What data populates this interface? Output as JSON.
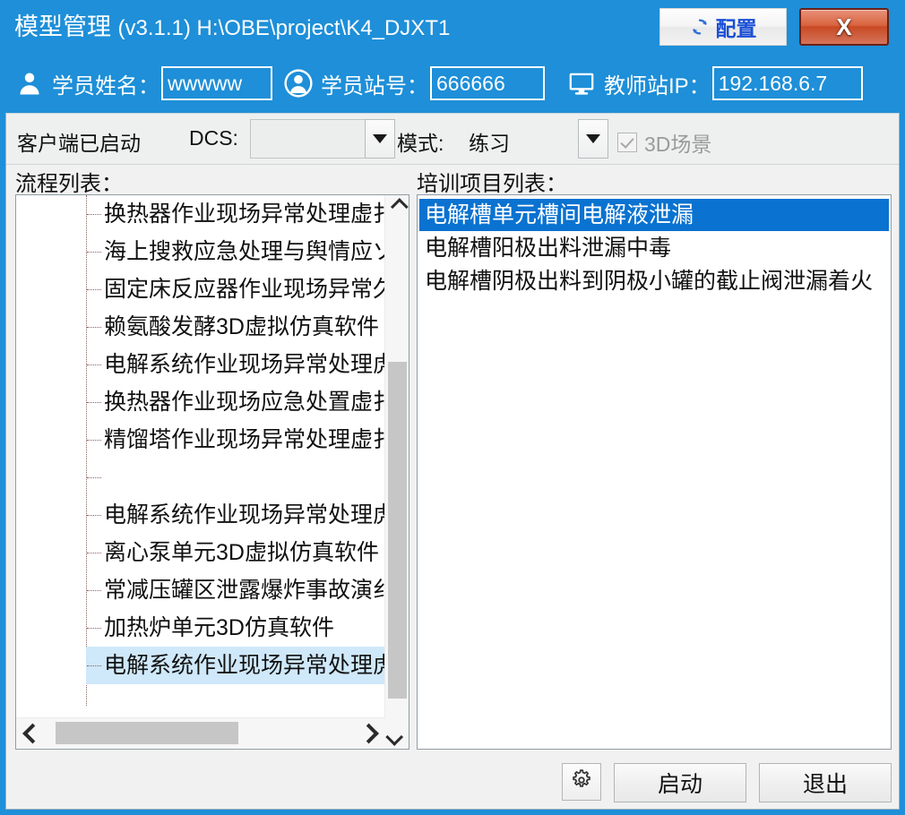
{
  "window": {
    "title_main": "模型管理",
    "title_version": "(v3.1.1) H:\\OBE\\project\\K4_DJXT1",
    "accent_blue": "#1e8fd8",
    "config_button": "配置",
    "close_button": "X"
  },
  "fields": {
    "student_name": {
      "label": "学员姓名：",
      "value": "wwwww",
      "placeholder": ""
    },
    "student_station": {
      "label": "学员站号：",
      "value": "666666",
      "placeholder": ""
    },
    "teacher_ip": {
      "label": "教师站IP：",
      "value": "192.168.6.7",
      "placeholder": ""
    }
  },
  "toolbar": {
    "status": "客户端已启动",
    "dcs_label": "DCS:",
    "dcs_value": "",
    "mode_label": "模式:",
    "mode_value": "练习",
    "scene3d_label": "3D场景",
    "scene3d_checked": true,
    "scene3d_disabled": true
  },
  "process_list": {
    "header": "流程列表：",
    "items": [
      {
        "label": "换热器作业现场异常处理虚扌",
        "selected": false
      },
      {
        "label": "海上搜救应急处理与舆情应ゾ",
        "selected": false
      },
      {
        "label": "固定床反应器作业现场异常久",
        "selected": false
      },
      {
        "label": "赖氨酸发酵3D虚拟仿真软件",
        "selected": false
      },
      {
        "label": "电解系统作业现场异常处理虎",
        "selected": false
      },
      {
        "label": "换热器作业现场应急处置虚扌",
        "selected": false
      },
      {
        "label": "精馏塔作业现场异常处理虚扌",
        "selected": false
      },
      {
        "label": "",
        "selected": false
      },
      {
        "label": "电解系统作业现场异常处理虎",
        "selected": false
      },
      {
        "label": "离心泵单元3D虚拟仿真软件",
        "selected": false
      },
      {
        "label": "常减压罐区泄露爆炸事故演纟",
        "selected": false
      },
      {
        "label": "加热炉单元3D仿真软件",
        "selected": false
      },
      {
        "label": "电解系统作业现场异常处理虎",
        "selected": true
      }
    ]
  },
  "training_list": {
    "header": "培训项目列表：",
    "items": [
      {
        "label": "电解槽单元槽间电解液泄漏",
        "selected": true
      },
      {
        "label": "电解槽阳极出料泄漏中毒",
        "selected": false
      },
      {
        "label": "电解槽阴极出料到阴极小罐的截止阀泄漏着火",
        "selected": false
      }
    ]
  },
  "buttons": {
    "settings_icon": "gear-icon",
    "start": "启动",
    "exit": "退出"
  }
}
